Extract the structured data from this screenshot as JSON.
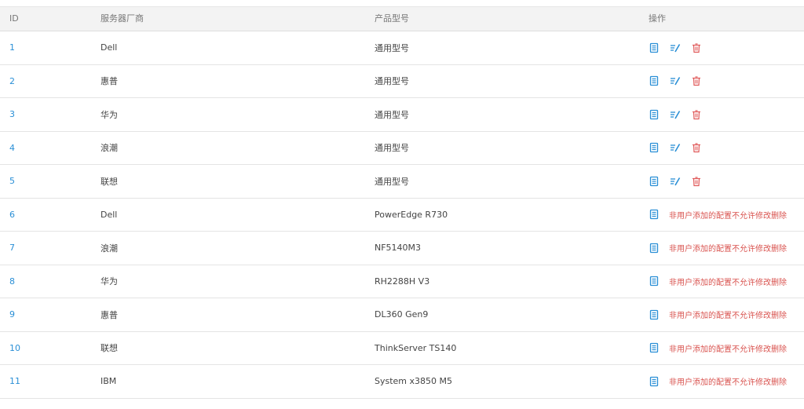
{
  "headers": {
    "id": "ID",
    "vendor": "服务器厂商",
    "model": "产品型号",
    "actions": "操作"
  },
  "colors": {
    "link": "#2a8fd6",
    "delete": "#e05a5a",
    "note": "#d9534f"
  },
  "rows": [
    {
      "id": "1",
      "vendor": "Dell",
      "model": "通用型号",
      "editable": true,
      "note": ""
    },
    {
      "id": "2",
      "vendor": "惠普",
      "model": "通用型号",
      "editable": true,
      "note": ""
    },
    {
      "id": "3",
      "vendor": "华为",
      "model": "通用型号",
      "editable": true,
      "note": ""
    },
    {
      "id": "4",
      "vendor": "浪潮",
      "model": "通用型号",
      "editable": true,
      "note": ""
    },
    {
      "id": "5",
      "vendor": "联想",
      "model": "通用型号",
      "editable": true,
      "note": ""
    },
    {
      "id": "6",
      "vendor": "Dell",
      "model": "PowerEdge R730",
      "editable": false,
      "note": "非用户添加的配置不允许修改删除"
    },
    {
      "id": "7",
      "vendor": "浪潮",
      "model": "NF5140M3",
      "editable": false,
      "note": "非用户添加的配置不允许修改删除"
    },
    {
      "id": "8",
      "vendor": "华为",
      "model": "RH2288H V3",
      "editable": false,
      "note": "非用户添加的配置不允许修改删除"
    },
    {
      "id": "9",
      "vendor": "惠普",
      "model": "DL360 Gen9",
      "editable": false,
      "note": "非用户添加的配置不允许修改删除"
    },
    {
      "id": "10",
      "vendor": "联想",
      "model": "ThinkServer TS140",
      "editable": false,
      "note": "非用户添加的配置不允许修改删除"
    },
    {
      "id": "11",
      "vendor": "IBM",
      "model": "System x3850 M5",
      "editable": false,
      "note": "非用户添加的配置不允许修改删除"
    }
  ],
  "icons": {
    "view": "document-icon",
    "edit": "edit-list-icon",
    "delete": "trash-icon"
  }
}
